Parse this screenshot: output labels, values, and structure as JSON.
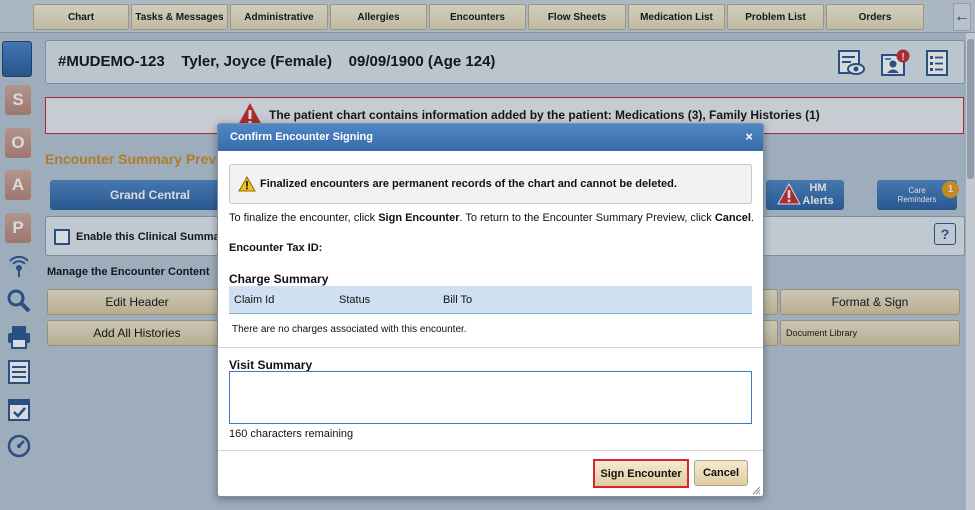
{
  "top_tabs": [
    "Chart",
    "Tasks & Messages",
    "Administrative",
    "Allergies",
    "Encounters",
    "Flow Sheets",
    "Medication List",
    "Problem List",
    "Orders"
  ],
  "sidebar": {
    "soap": [
      "S",
      "O",
      "A",
      "P"
    ]
  },
  "patient": {
    "header": "#MUDEMO-123    Tyler, Joyce (Female)    09/09/1900 (Age 124)"
  },
  "alert": {
    "text": "The patient chart contains information added by the patient: Medications (3), Family Histories (1)"
  },
  "encounter": {
    "title": "Encounter Summary Previe"
  },
  "toolbar": {
    "grand_central": "Grand Central",
    "hm_line1": "HM",
    "hm_line2": "Alerts",
    "care_line1": "Care",
    "care_line2": "Reminders",
    "care_badge": "1"
  },
  "clinical": {
    "label": "Enable this Clinical Summary",
    "help": "?"
  },
  "manage": {
    "label": "Manage the Encounter Content",
    "edit_header": "Edit Header",
    "add_histories": "Add All Histories",
    "format_sign": "Format & Sign",
    "document_library": "Document Library"
  },
  "modal": {
    "title": "Confirm Encounter Signing",
    "close": "×",
    "warning": "Finalized encounters are permanent records of the chart and cannot be deleted.",
    "instr_1": "To finalize the encounter, click ",
    "instr_sign": "Sign Encounter",
    "instr_2": ". To return to the Encounter Summary Preview, click ",
    "instr_cancel": "Cancel",
    "instr_3": ".",
    "tax_id_label": "Encounter Tax ID:",
    "charge_summary": "Charge Summary",
    "columns": [
      "Claim Id",
      "Status",
      "Bill To"
    ],
    "no_charges": "There are no charges associated with this encounter.",
    "visit_summary": "Visit Summary",
    "visit_value": "",
    "remaining": "160 characters remaining",
    "sign_button": "Sign Encounter",
    "cancel_button": "Cancel"
  },
  "colors": {
    "accent_blue": "#2b5f9f",
    "alert_red": "#cc2233",
    "title_orange": "#d08a22",
    "highlight_red": "#d9232d"
  }
}
